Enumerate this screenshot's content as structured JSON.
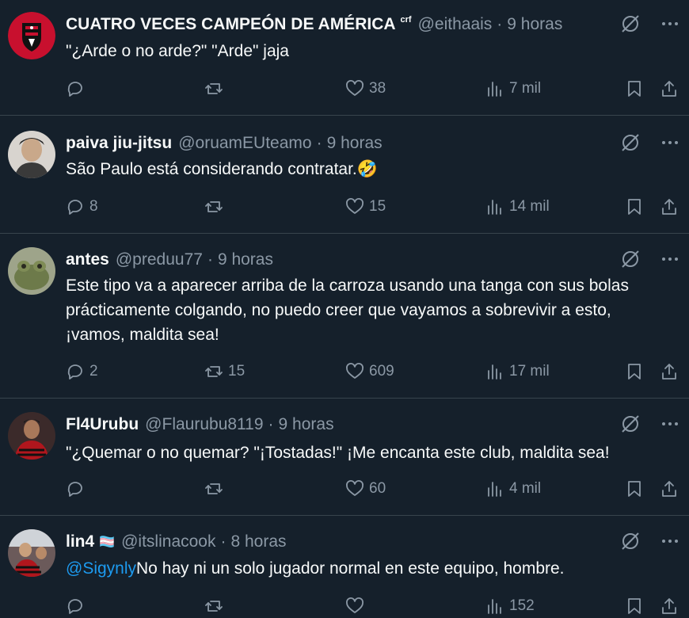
{
  "tweets": [
    {
      "name": "CUATRO VECES CAMPEÓN DE AMÉRICA",
      "badge": "crf",
      "handle": "@eithaais",
      "dot": "·",
      "time": "9 horas",
      "mention": "",
      "text_lines": [
        "\"¿Arde o no arde?\" \"Arde\" jaja"
      ],
      "replies": "",
      "retweets": "",
      "likes": "38",
      "views": "7 mil",
      "avatar": "flamengo-crest"
    },
    {
      "name": "paiva jiu-jitsu",
      "badge": "",
      "handle": "@oruamEUteamo",
      "dot": "·",
      "time": "9 horas",
      "mention": "",
      "text_lines": [
        "São Paulo está considerando contratar.🤣"
      ],
      "replies": "8",
      "retweets": "",
      "likes": "15",
      "views": "14 mil",
      "avatar": "person-photo"
    },
    {
      "name": "antes",
      "badge": "",
      "handle": "@preduu77",
      "dot": "·",
      "time": "9 horas",
      "mention": "",
      "text_lines": [
        "Este tipo va a aparecer arriba de la carroza usando una tanga con sus bolas",
        "prácticamente colgando, no puedo creer que vayamos a sobrevivir a esto,",
        "¡vamos, maldita sea!"
      ],
      "replies": "2",
      "retweets": "15",
      "likes": "609",
      "views": "17 mil",
      "avatar": "frog-photo"
    },
    {
      "name": "Fl4Urubu",
      "badge": "",
      "handle": "@Flaurubu8119",
      "dot": "·",
      "time": "9 horas",
      "mention": "",
      "text_lines": [
        "\"¿Quemar o no quemar? \"¡Tostadas!\" ¡Me encanta este club, maldita sea!"
      ],
      "replies": "",
      "retweets": "",
      "likes": "60",
      "views": "4 mil",
      "avatar": "player-photo"
    },
    {
      "name": "lin4",
      "badge": "🏳️‍⚧️",
      "handle": "@itslinacook",
      "dot": "·",
      "time": "8 horas",
      "mention": "@Sigynly",
      "text_lines": [
        "No hay ni un solo jugador normal en este equipo, hombre."
      ],
      "replies": "",
      "retweets": "",
      "likes": "",
      "views": "152",
      "avatar": "crowd-photo"
    }
  ],
  "colors": {
    "background": "#15202b",
    "text": "#f7f9f9",
    "secondary": "#8b98a5",
    "link": "#1d9bf0",
    "divider": "#38444d"
  },
  "icons": {
    "header": [
      "grok-icon",
      "more-icon"
    ],
    "actions": [
      "reply-icon",
      "retweet-icon",
      "like-icon",
      "views-icon",
      "bookmark-icon",
      "share-icon"
    ]
  }
}
